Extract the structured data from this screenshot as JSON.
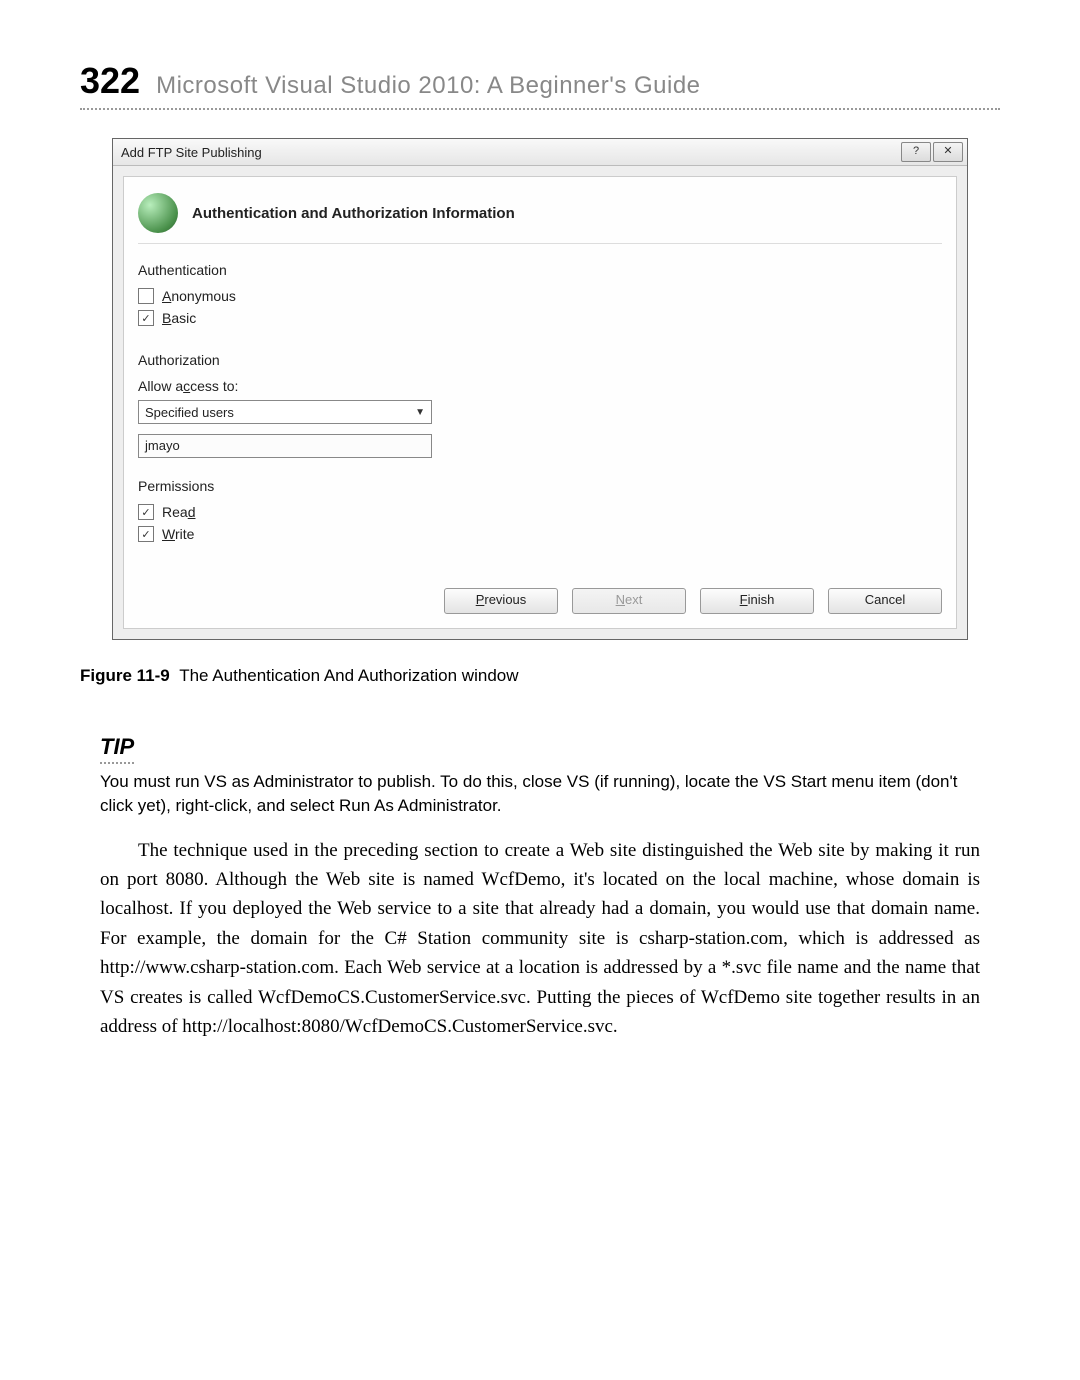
{
  "page": {
    "number": "322",
    "title": "Microsoft Visual Studio 2010: A Beginner's Guide"
  },
  "dialog": {
    "window_title": "Add FTP Site Publishing",
    "help_btn": "?",
    "close_btn": "✕",
    "heading": "Authentication and Authorization Information",
    "auth_section": "Authentication",
    "anonymous_label_pre": "A",
    "anonymous_label_rest": "nonymous",
    "anonymous_checked": "",
    "basic_label_pre": "B",
    "basic_label_rest": "asic",
    "basic_checked": "✓",
    "authz_section": "Authorization",
    "allow_access_pre": "Allow a",
    "allow_access_u": "c",
    "allow_access_rest": "cess to:",
    "select_value": "Specified users",
    "user_value": "jmayo",
    "perm_section": "Permissions",
    "read_pre": "Rea",
    "read_u": "d",
    "read_checked": "✓",
    "write_u": "W",
    "write_rest": "rite",
    "write_checked": "✓",
    "buttons": {
      "previous_u": "P",
      "previous_rest": "revious",
      "next_u": "N",
      "next_rest": "ext",
      "finish_u": "F",
      "finish_rest": "inish",
      "cancel": "Cancel"
    }
  },
  "figure": {
    "num": "Figure 11-9",
    "caption": "The Authentication And Authorization window"
  },
  "tip": {
    "heading": "TIP",
    "text": "You must run VS as Administrator to publish. To do this, close VS (if running), locate the VS Start menu item (don't click yet), right-click, and select Run As Administrator."
  },
  "body": {
    "para": "The technique used in the preceding section to create a Web site distinguished the Web site by making it run on port 8080. Although the Web site is named WcfDemo, it's located on the local machine, whose domain is localhost. If you deployed the Web service to a site that already had a domain, you would use that domain name. For example, the domain for the C# Station community site is csharp-station.com, which is addressed as http://www.csharp-station.com. Each Web service at a location is addressed by a *.svc file name and the name that VS creates is called WcfDemoCS.CustomerService.svc. Putting the pieces of WcfDemo site together results in an address of http://localhost:8080/WcfDemoCS.CustomerService.svc."
  }
}
